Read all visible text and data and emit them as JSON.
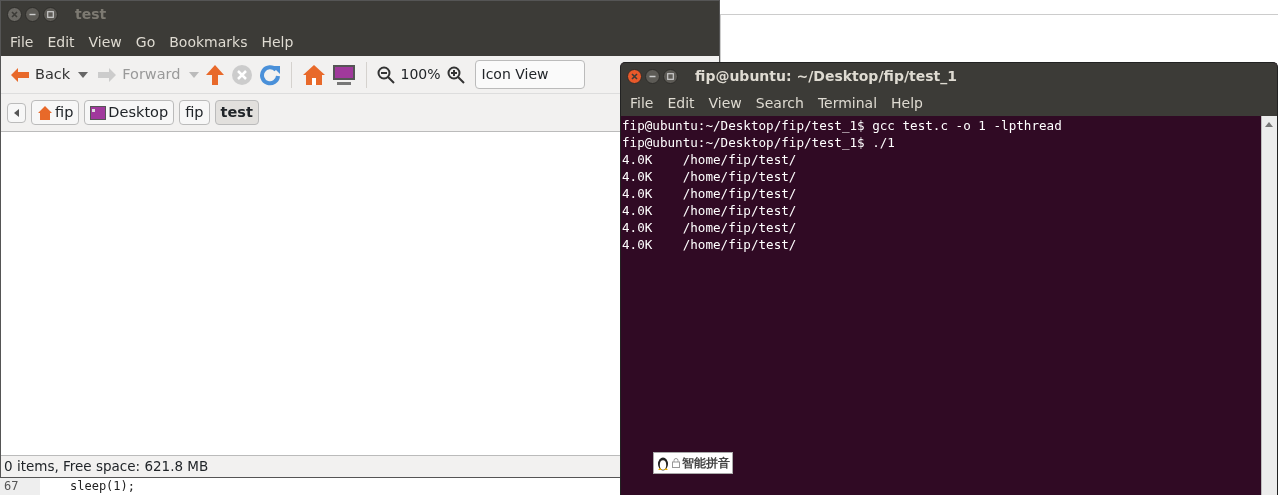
{
  "file_manager": {
    "title": "test",
    "menu": [
      "File",
      "Edit",
      "View",
      "Go",
      "Bookmarks",
      "Help"
    ],
    "toolbar": {
      "back": {
        "label": "Back",
        "disabled": false
      },
      "forward": {
        "label": "Forward",
        "disabled": true
      },
      "stop_disabled": true,
      "zoom": "100%",
      "view_mode": "Icon View"
    },
    "breadcrumbs": [
      {
        "label": "fip",
        "kind": "home",
        "selected": false
      },
      {
        "label": "Desktop",
        "kind": "desktop",
        "selected": false
      },
      {
        "label": "fip",
        "kind": "plain",
        "selected": false
      },
      {
        "label": "test",
        "kind": "plain",
        "selected": true
      }
    ],
    "status": "0 items, Free space: 621.8 MB"
  },
  "editor": {
    "lines": [
      {
        "number": "67",
        "code": "sleep(1);"
      }
    ]
  },
  "terminal": {
    "title": "fip@ubuntu: ~/Desktop/fip/test_1",
    "menu": [
      "File",
      "Edit",
      "View",
      "Search",
      "Terminal",
      "Help"
    ],
    "lines": [
      "fip@ubuntu:~/Desktop/fip/test_1$ gcc test.c -o 1 -lpthread",
      "fip@ubuntu:~/Desktop/fip/test_1$ ./1",
      "4.0K    /home/fip/test/",
      "4.0K    /home/fip/test/",
      "4.0K    /home/fip/test/",
      "4.0K    /home/fip/test/",
      "4.0K    /home/fip/test/",
      "4.0K    /home/fip/test/"
    ]
  },
  "input_method": {
    "label": "智能拼音"
  }
}
